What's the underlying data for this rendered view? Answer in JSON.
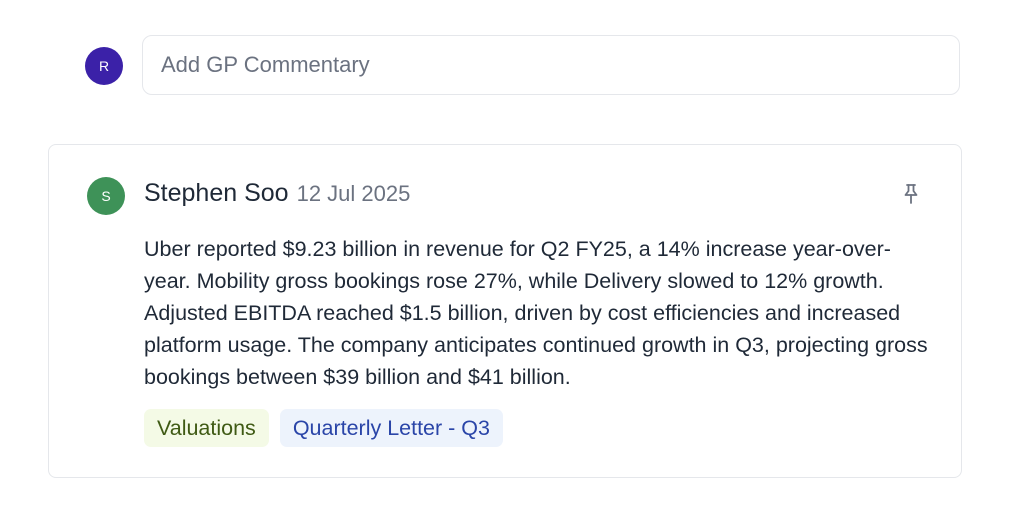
{
  "composer": {
    "avatar_initial": "R",
    "placeholder": "Add GP Commentary"
  },
  "comment": {
    "avatar_initial": "S",
    "author": "Stephen Soo",
    "date": "12 Jul 2025",
    "body": "Uber reported $9.23 billion in revenue for Q2 FY25, a 14% increase year-over-year. Mobility gross bookings rose 27%, while Delivery slowed to 12% growth. Adjusted EBITDA reached $1.5 billion, driven by cost efficiencies and increased platform usage. The company anticipates continued growth in Q3, projecting gross bookings between $39 billion and $41 billion.",
    "tags": [
      {
        "label": "Valuations",
        "color": "green"
      },
      {
        "label": "Quarterly Letter - Q3",
        "color": "blue"
      }
    ],
    "pin_icon": "pin-icon"
  },
  "colors": {
    "composer_avatar": "#3b21a8",
    "author_avatar": "#3e9258",
    "tag_green_bg": "#f4fae6",
    "tag_blue_bg": "#edf3fc"
  }
}
